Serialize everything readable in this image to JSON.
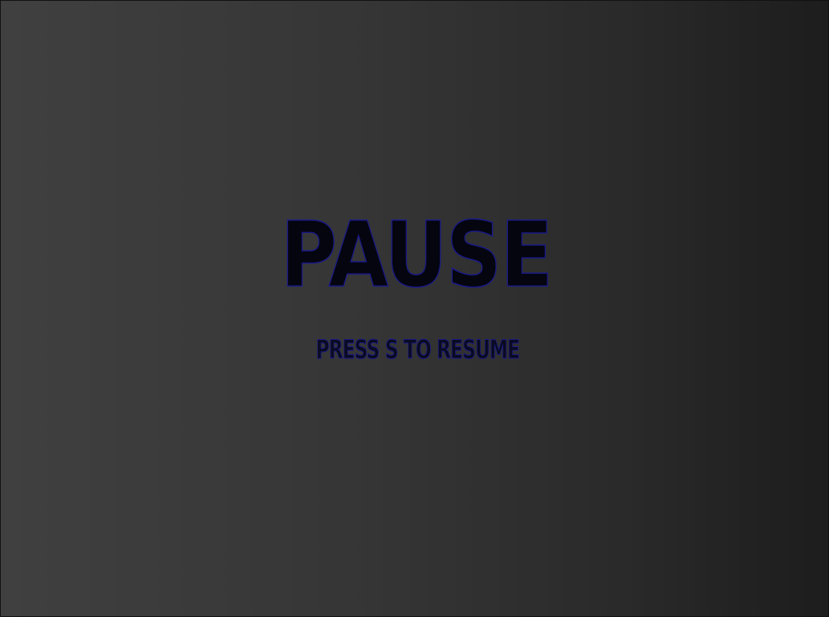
{
  "pause_screen": {
    "title": "PAUSE",
    "hint": "PRESS S TO RESUME"
  },
  "colors": {
    "background_left": "#404040",
    "background_right": "#1d1d1d",
    "text_fill": "#050510",
    "text_outline": "#1a1a8a"
  }
}
